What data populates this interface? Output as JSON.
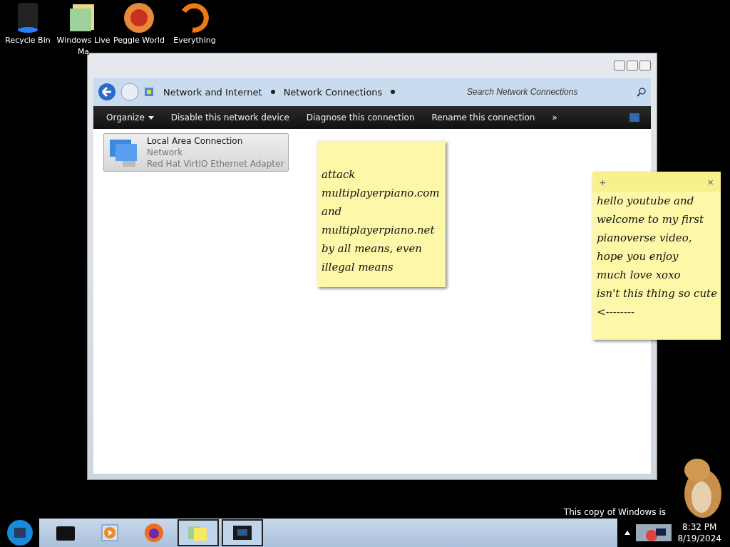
{
  "desktop_icons": [
    {
      "kind": "bin",
      "lines": [
        "Recycle Bin"
      ]
    },
    {
      "kind": "folder",
      "lines": [
        "Windows Live",
        "Ma"
      ]
    },
    {
      "kind": "peggle",
      "lines": [
        "Peggle World"
      ]
    },
    {
      "kind": "ring",
      "lines": [
        "Everything"
      ]
    }
  ],
  "window": {
    "breadcrumb": [
      "Network and Internet",
      "Network Connections"
    ],
    "search": {
      "placeholder": "Search Network Connections"
    },
    "toolbar": [
      {
        "label": "Organize",
        "kind": "menu"
      },
      {
        "label": "Disable this network device",
        "kind": "button"
      },
      {
        "label": "Diagnose this connection",
        "kind": "button"
      },
      {
        "label": "Rename this connection",
        "kind": "button"
      },
      {
        "label": "»",
        "kind": "button"
      }
    ],
    "items": [
      {
        "title": "Local Area Connection",
        "lines": [
          "Network",
          "Red Hat VirtIO Ethernet Adapter"
        ],
        "selected": true
      }
    ]
  },
  "sticky_notes": [
    {
      "kind": "plain",
      "lines": [
        "attack",
        "multiplayerpiano.com",
        "and",
        "multiplayerpiano.net",
        "by all means, even",
        "illegal means"
      ]
    },
    {
      "kind": "header",
      "add": "+",
      "close": "×",
      "lines": [
        "hello youtube and",
        "welcome to my first",
        "pianoverse video,",
        "hope you enjoy",
        "much love xoxo",
        "isn't this thing so cute",
        "<--------"
      ]
    }
  ],
  "watermark_text": "This copy of Windows is",
  "taskbar": {
    "apps": [
      {
        "kind": "terminal",
        "selected": false
      },
      {
        "kind": "media",
        "selected": false
      },
      {
        "kind": "browser",
        "selected": false
      },
      {
        "kind": "notes",
        "selected": true
      },
      {
        "kind": "network",
        "selected": true
      }
    ],
    "clock": {
      "time": "8:32 PM",
      "date": "8/19/2024"
    }
  }
}
